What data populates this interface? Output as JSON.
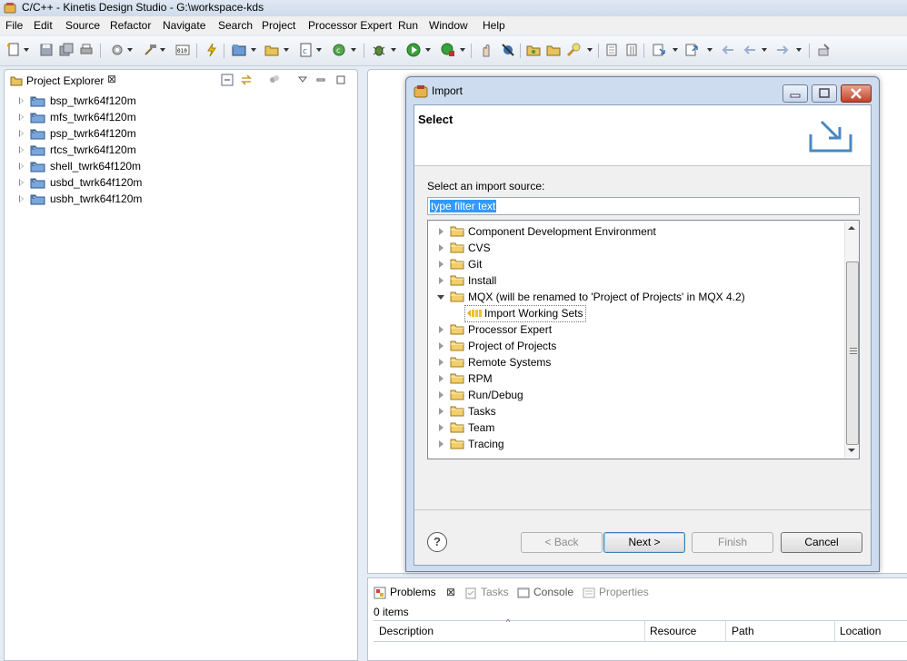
{
  "window": {
    "title": "C/C++ - Kinetis Design Studio - G:\\workspace-kds"
  },
  "menu": [
    "File",
    "Edit",
    "Source",
    "Refactor",
    "Navigate",
    "Search",
    "Project",
    "Processor Expert",
    "Run",
    "Window",
    "Help"
  ],
  "project_explorer": {
    "tab_label": "Project Explorer",
    "projects": [
      "bsp_twrk64f120m",
      "mfs_twrk64f120m",
      "psp_twrk64f120m",
      "rtcs_twrk64f120m",
      "shell_twrk64f120m",
      "usbd_twrk64f120m",
      "usbh_twrk64f120m"
    ]
  },
  "dialog": {
    "title": "Import",
    "heading": "Select",
    "source_label": "Select an import source:",
    "filter_value": "type filter text",
    "items": [
      {
        "label": "Component Development Environment"
      },
      {
        "label": "CVS"
      },
      {
        "label": "Git"
      },
      {
        "label": "Install"
      },
      {
        "label": "MQX (will be renamed to 'Project of Projects' in MQX 4.2)",
        "expanded": true
      },
      {
        "label": "Import Working Sets",
        "child": true
      },
      {
        "label": "Processor Expert"
      },
      {
        "label": "Project of Projects"
      },
      {
        "label": "Remote Systems"
      },
      {
        "label": "RPM"
      },
      {
        "label": "Run/Debug"
      },
      {
        "label": "Tasks"
      },
      {
        "label": "Team"
      },
      {
        "label": "Tracing"
      }
    ],
    "buttons": {
      "back": "< Back",
      "next": "Next >",
      "finish": "Finish",
      "cancel": "Cancel"
    }
  },
  "bottom_panel": {
    "tabs": [
      "Problems",
      "Tasks",
      "Console",
      "Properties"
    ],
    "items_count": "0 items",
    "columns": [
      "Description",
      "Resource",
      "Path",
      "Location"
    ]
  }
}
